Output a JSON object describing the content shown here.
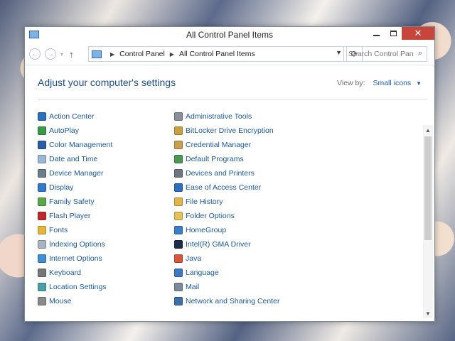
{
  "window": {
    "title": "All Control Panel Items",
    "close_label": "✕"
  },
  "nav": {
    "back_glyph": "←",
    "forward_glyph": "→",
    "recent_glyph": "▾",
    "up_glyph": "↑",
    "breadcrumb": [
      "Control Panel",
      "All Control Panel Items"
    ],
    "refresh_glyph": "⟳"
  },
  "search": {
    "placeholder": "Search Control Panel",
    "icon": "search-icon"
  },
  "content": {
    "heading": "Adjust your computer's settings",
    "view_by_label": "View by:",
    "view_by_value": "Small icons"
  },
  "items": {
    "left": [
      {
        "label": "Action Center",
        "icon": "flag-icon",
        "color": "#2b6fbd"
      },
      {
        "label": "AutoPlay",
        "icon": "autoplay-icon",
        "color": "#3a9a4a"
      },
      {
        "label": "Color Management",
        "icon": "color-management-icon",
        "color": "#2a5da8"
      },
      {
        "label": "Date and Time",
        "icon": "clock-icon",
        "color": "#9ab6d8"
      },
      {
        "label": "Device Manager",
        "icon": "device-manager-icon",
        "color": "#6b7c8d"
      },
      {
        "label": "Display",
        "icon": "display-icon",
        "color": "#2f7bc9"
      },
      {
        "label": "Family Safety",
        "icon": "family-safety-icon",
        "color": "#58a845"
      },
      {
        "label": "Flash Player",
        "icon": "flash-icon",
        "color": "#c0282d"
      },
      {
        "label": "Fonts",
        "icon": "fonts-icon",
        "color": "#e4b63a"
      },
      {
        "label": "Indexing Options",
        "icon": "indexing-icon",
        "color": "#a8b4c0"
      },
      {
        "label": "Internet Options",
        "icon": "internet-icon",
        "color": "#3f8fd4"
      },
      {
        "label": "Keyboard",
        "icon": "keyboard-icon",
        "color": "#777777"
      },
      {
        "label": "Location Settings",
        "icon": "location-icon",
        "color": "#4aa0a8"
      },
      {
        "label": "Mouse",
        "icon": "mouse-icon",
        "color": "#8a8a8a"
      }
    ],
    "right": [
      {
        "label": "Administrative Tools",
        "icon": "admin-tools-icon",
        "color": "#8a8f99"
      },
      {
        "label": "BitLocker Drive Encryption",
        "icon": "bitlocker-icon",
        "color": "#c9a042"
      },
      {
        "label": "Credential Manager",
        "icon": "credential-icon",
        "color": "#c8a050"
      },
      {
        "label": "Default Programs",
        "icon": "default-programs-icon",
        "color": "#4a9a55"
      },
      {
        "label": "Devices and Printers",
        "icon": "printer-icon",
        "color": "#6d7580"
      },
      {
        "label": "Ease of Access Center",
        "icon": "ease-access-icon",
        "color": "#2d6fbf"
      },
      {
        "label": "File History",
        "icon": "file-history-icon",
        "color": "#e1b848"
      },
      {
        "label": "Folder Options",
        "icon": "folder-icon",
        "color": "#e6c25a"
      },
      {
        "label": "HomeGroup",
        "icon": "homegroup-icon",
        "color": "#3a7fc7"
      },
      {
        "label": "Intel(R) GMA Driver",
        "icon": "intel-icon",
        "color": "#1d2c4a"
      },
      {
        "label": "Java",
        "icon": "java-icon",
        "color": "#d8563a"
      },
      {
        "label": "Language",
        "icon": "language-icon",
        "color": "#3e78c0"
      },
      {
        "label": "Mail",
        "icon": "mail-icon",
        "color": "#7d8a99"
      },
      {
        "label": "Network and Sharing Center",
        "icon": "network-icon",
        "color": "#3f6fa8"
      }
    ]
  }
}
